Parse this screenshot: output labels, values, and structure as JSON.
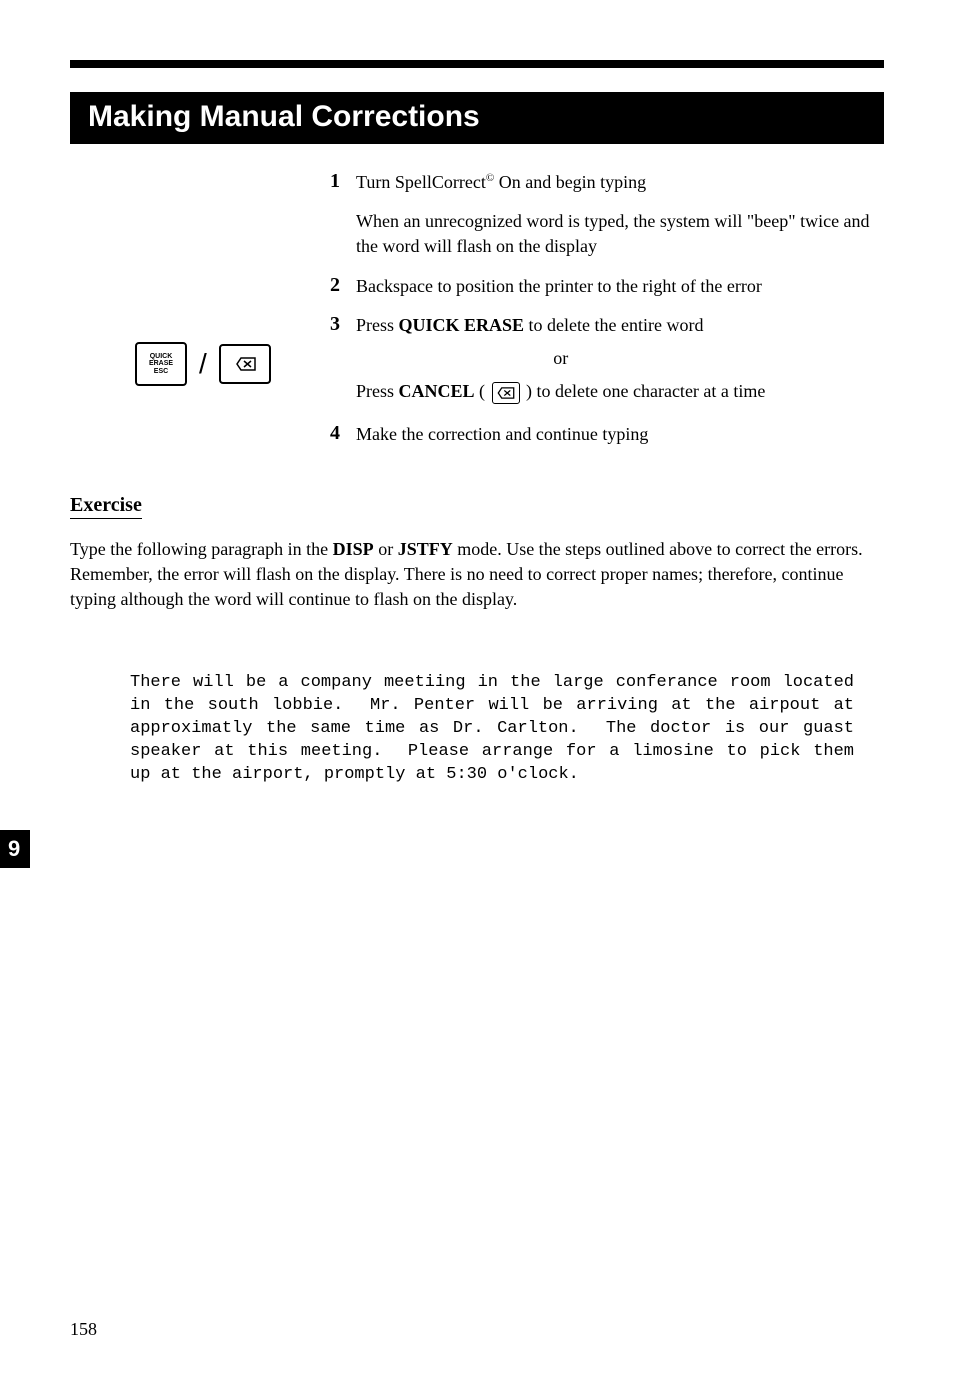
{
  "title": "Making Manual Corrections",
  "steps": [
    {
      "num": "1",
      "text_pre": "Turn SpellCorrect",
      "reg": "©",
      "text_post": " On and begin typing",
      "sub": "When an unrecognized word is typed, the system will \"beep\" twice and the word will flash on the display"
    },
    {
      "num": "2",
      "text": "Backspace to position the printer to the right of the error"
    },
    {
      "num": "3",
      "prefix": "Press ",
      "bold": "QUICK ERASE",
      "suffix": " to delete the entire word",
      "or": "or",
      "line2_prefix": "Press ",
      "line2_bold": "CANCEL",
      "line2_open": " ( ",
      "line2_close": " ) to delete one character at a time"
    },
    {
      "num": "4",
      "text": "Make the correction and continue typing"
    }
  ],
  "keys": {
    "quick_erase": [
      "QUICK",
      "ERASE",
      "ESC"
    ],
    "slash": "/"
  },
  "exercise": {
    "heading": "Exercise",
    "intro_pre": "Type the following paragraph in the ",
    "intro_bold1": "DISP",
    "intro_mid": " or ",
    "intro_bold2": "JSTFY",
    "intro_post": " mode. Use the steps outlined above to correct the errors. Remember, the error will flash on the display. There is no need to correct proper names; therefore, continue typing although the word will continue to flash on the display.",
    "typed": "There will be a company meetiing in the large conferance room located in the south lobbie.  Mr. Penter will be arriving at the airpout at approximatly the same time as Dr. Carlton.  The doctor is our guast speaker at this meeting.  Please arrange for a limosine to pick them up at the airport, promptly at 5:30 o'clock."
  },
  "tab": "9",
  "page_number": "158"
}
